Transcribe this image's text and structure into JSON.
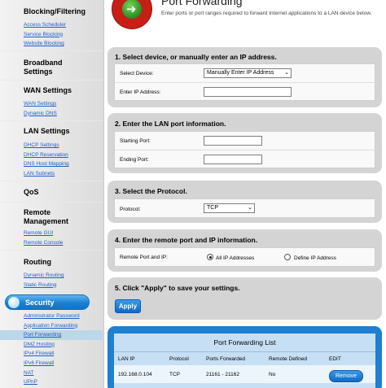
{
  "sidebar": {
    "blocking": {
      "heading": "Blocking/Filtering",
      "links": [
        "Access Scheduler",
        "Service Blocking",
        "Website Blocking"
      ]
    },
    "broadband": {
      "heading_line1": "Broadband",
      "heading_line2": "Settings"
    },
    "wan": {
      "heading": "WAN Settings",
      "links": [
        "WAN Settings",
        "Dynamic DNS"
      ]
    },
    "lan": {
      "heading": "LAN Settings",
      "links": [
        "DHCP Settings",
        "DHCP Reservation",
        "DNS Host Mapping",
        "LAN Subnets"
      ]
    },
    "qos": {
      "heading": "QoS"
    },
    "remote": {
      "heading_line1": "Remote",
      "heading_line2": "Management",
      "links": [
        "Remote GUI",
        "Remote Console"
      ]
    },
    "routing": {
      "heading": "Routing",
      "links": [
        "Dynamic Routing",
        "Static Routing"
      ]
    },
    "security": {
      "heading": "Security",
      "links": [
        "Administrator Password",
        "Application Forwarding",
        "Port Forwarding",
        "DMZ Hosting",
        "IPv4 Firewall",
        "IPv6 Firewall",
        "NAT",
        "UPnP"
      ],
      "active_index": 2
    }
  },
  "header": {
    "title": "Port Forwarding",
    "description": "Enter ports or port ranges required to forward Internet applications to a LAN device below."
  },
  "step1": {
    "title": "1. Select device, or manually enter an IP address.",
    "device_label": "Select Device:",
    "device_value": "Manually Enter IP Address",
    "ip_label": "Enter IP Address:",
    "ip_value": ""
  },
  "step2": {
    "title": "2. Enter the LAN port information.",
    "start_label": "Starting Port:",
    "start_value": "",
    "end_label": "Ending Port:",
    "end_value": ""
  },
  "step3": {
    "title": "3. Select the Protocol.",
    "protocol_label": "Protocol:",
    "protocol_value": "TCP"
  },
  "step4": {
    "title": "4. Enter the remote port and IP information.",
    "remote_label": "Remote Port and IP:",
    "option_all": "All IP Addresses",
    "option_define": "Define IP Address",
    "selected": "all"
  },
  "step5": {
    "title": "5. Click \"Apply\" to save your settings.",
    "apply_label": "Apply"
  },
  "list": {
    "title": "Port Forwarding List",
    "columns": [
      "LAN IP",
      "Protocol",
      "Ports Forwarded",
      "Remote Defined",
      "EDIT"
    ],
    "rows": [
      {
        "lan_ip": "192.168.0.104",
        "protocol": "TCP",
        "ports": "21161 - 21162",
        "remote": "No",
        "edit": "Remove"
      }
    ]
  },
  "colors": {
    "link": "#1e5ec8",
    "panel": "#d4d4d4",
    "accent_blue": "#1f7fd1",
    "logo_red": "#c51f16",
    "logo_green": "#2e9a2b"
  }
}
